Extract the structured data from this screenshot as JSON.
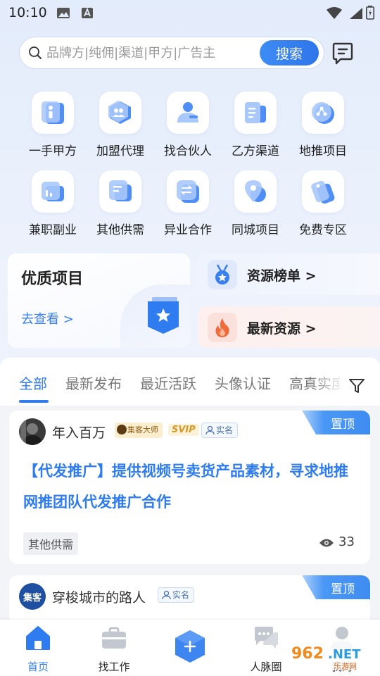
{
  "status_bar": {
    "time": "10:10"
  },
  "search": {
    "placeholder": "品牌方|纯佣|渠道|甲方|广告主",
    "button_label": "搜索"
  },
  "categories": [
    {
      "label": "一手甲方",
      "icon": "person-tie-icon"
    },
    {
      "label": "加盟代理",
      "icon": "group-icon"
    },
    {
      "label": "找合伙人",
      "icon": "partner-icon"
    },
    {
      "label": "乙方渠道",
      "icon": "document-icon"
    },
    {
      "label": "地推项目",
      "icon": "network-icon"
    },
    {
      "label": "兼职副业",
      "icon": "chart-icon"
    },
    {
      "label": "其他供需",
      "icon": "chat-icon"
    },
    {
      "label": "异业合作",
      "icon": "exchange-icon"
    },
    {
      "label": "同城项目",
      "icon": "location-icon"
    },
    {
      "label": "免费专区",
      "icon": "tag-icon"
    }
  ],
  "promo": {
    "main_title": "优质项目",
    "main_link": "去查看 >",
    "resource_rank": "资源榜单 >",
    "latest_resource": "最新资源 >"
  },
  "tabs": [
    "全部",
    "最新发布",
    "最近活跃",
    "头像认证",
    "高真实度"
  ],
  "posts": [
    {
      "author": "年入百万",
      "master_badge": "集客大师",
      "svip": "SVIP",
      "realname": "实名",
      "pinned": "置顶",
      "title": "【代发推广】提供视频号卖货产品素材，寻求地推网推团队代发推广合作",
      "tag": "其他供需",
      "views": "33"
    },
    {
      "author": "穿梭城市的路人",
      "realname": "实名",
      "pinned": "置顶",
      "avatar_text": "集客"
    }
  ],
  "bottom_nav": {
    "home": "首页",
    "jobs": "找工作",
    "network": "人脉圈",
    "mine": "我的"
  },
  "watermark": {
    "text": "962.NET",
    "sub": "乐游网"
  },
  "colors": {
    "accent": "#2f7cf0",
    "pin": "#3f8cf2",
    "fire": "#f06a3a"
  }
}
